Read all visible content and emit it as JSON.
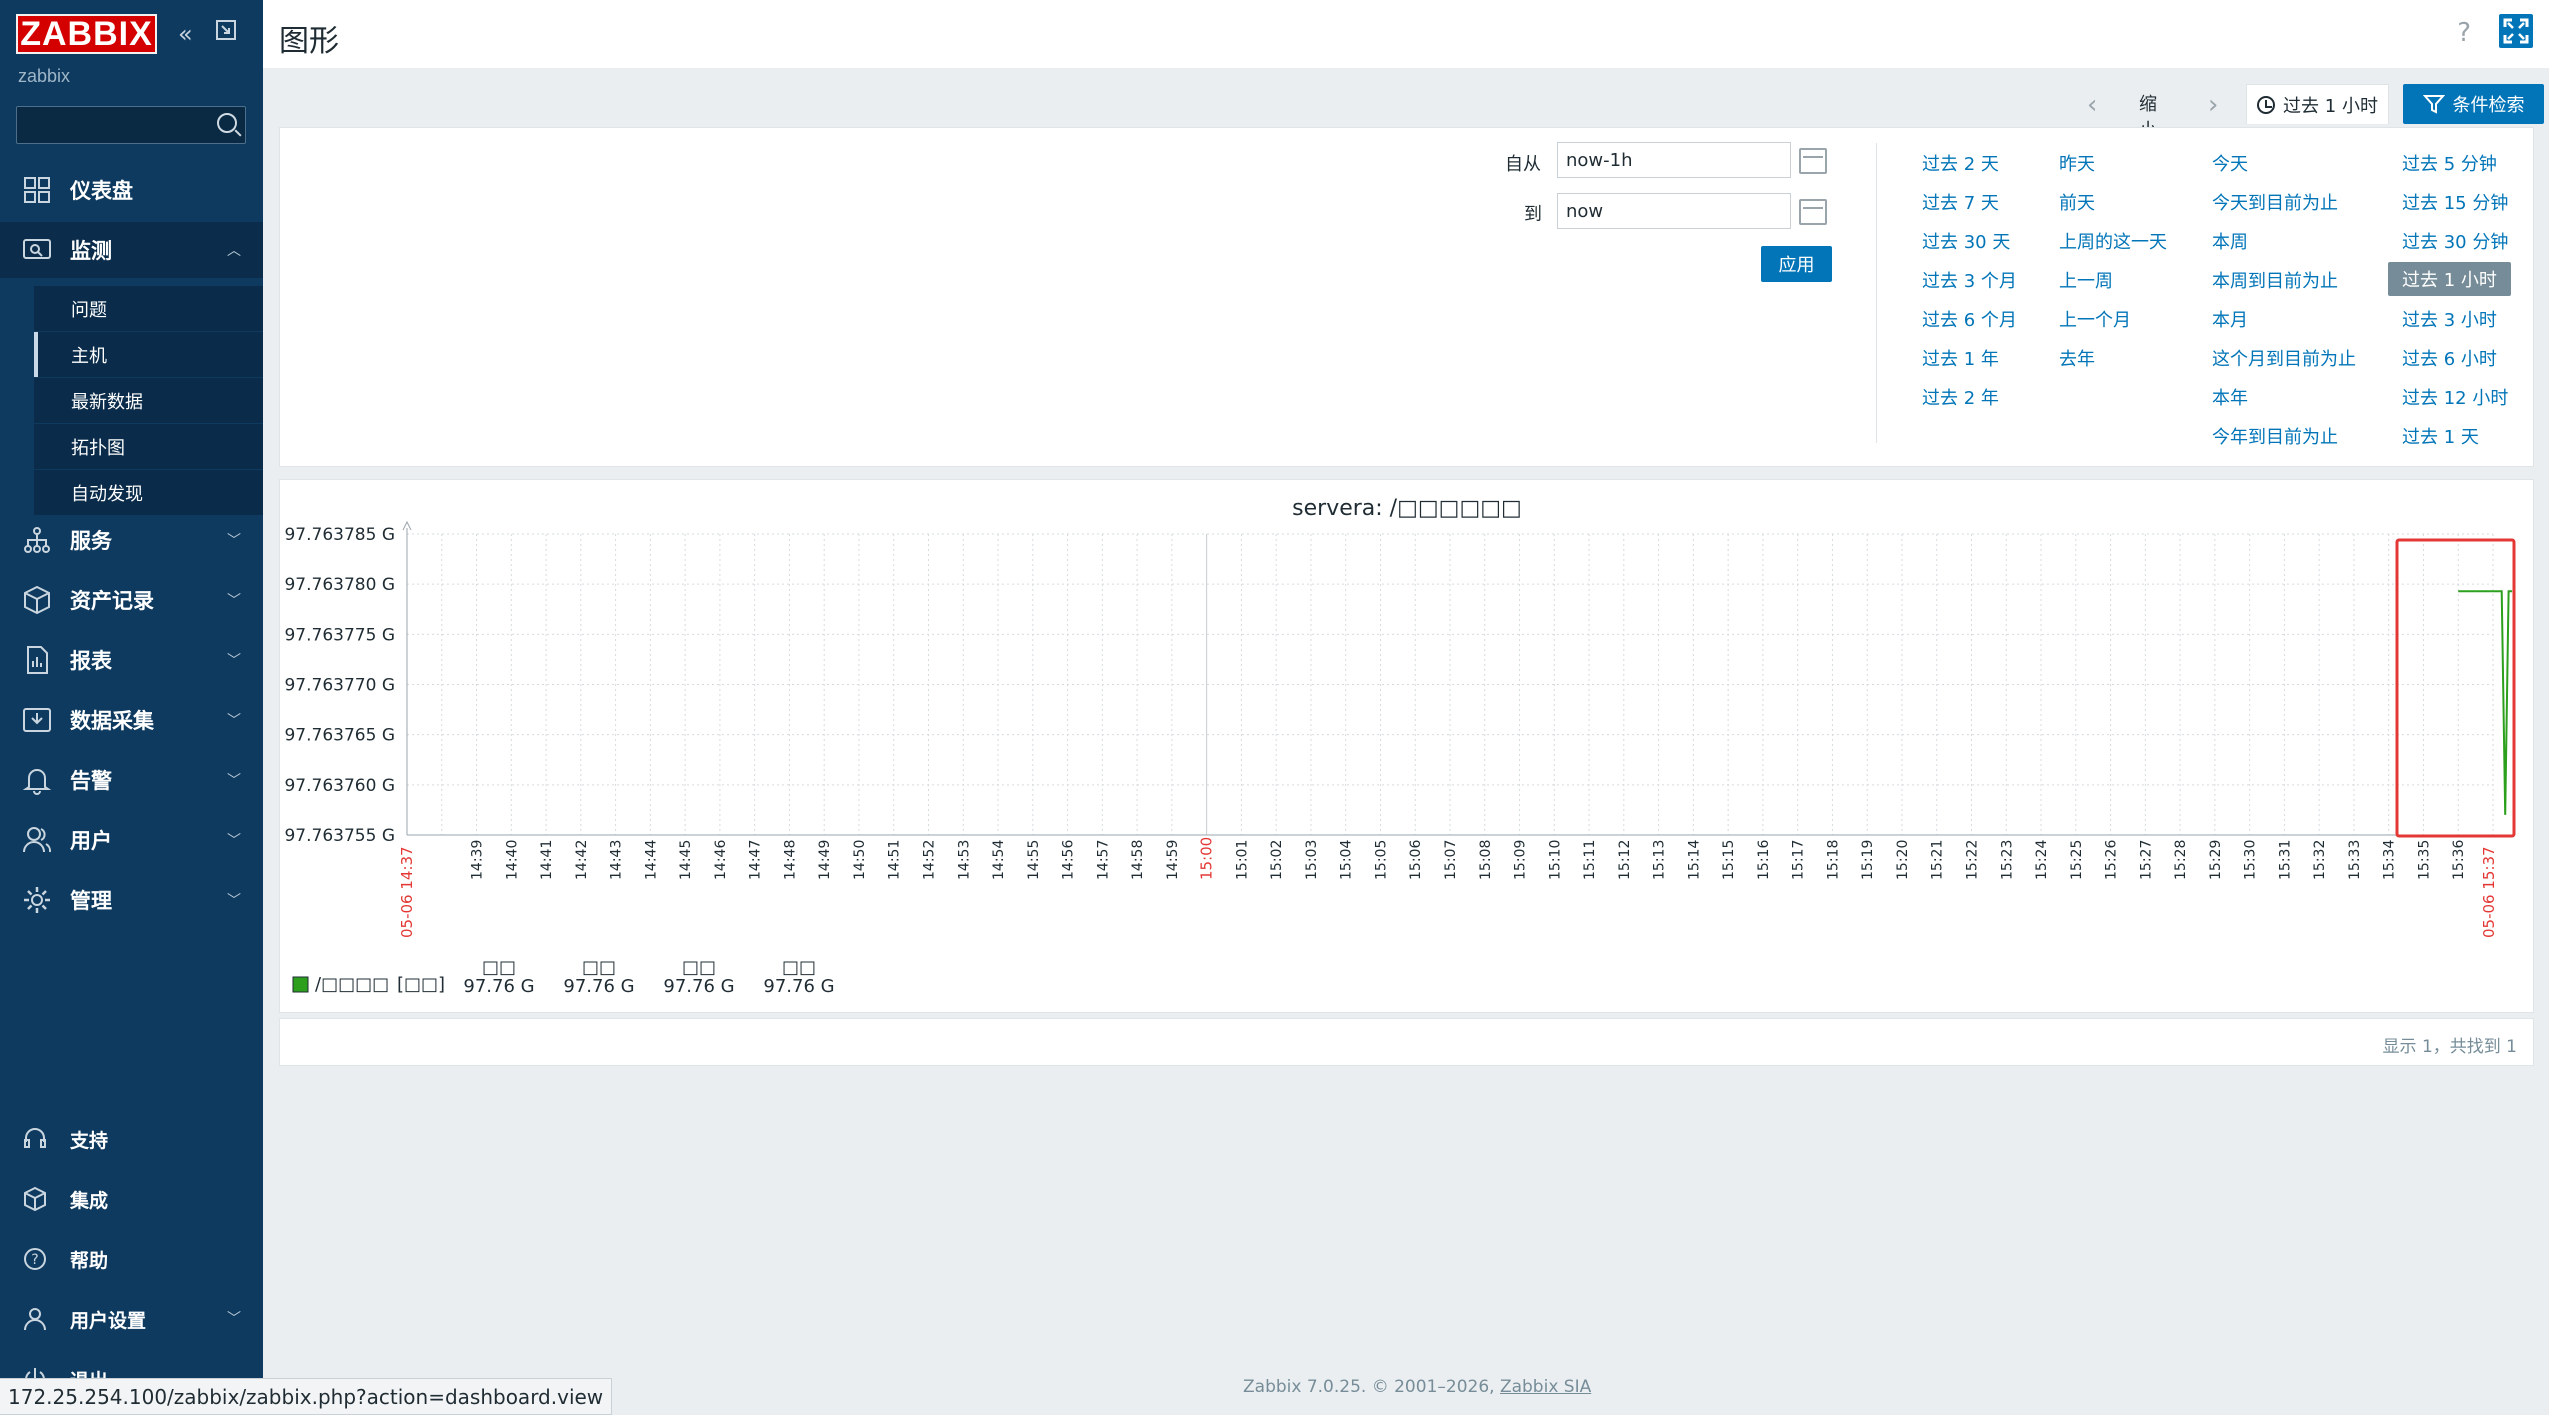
{
  "sidebar": {
    "logo": "ZABBIX",
    "instance": "zabbix",
    "search_placeholder": "",
    "items": [
      {
        "label": "仪表盘",
        "icon": "dashboard-icon"
      },
      {
        "label": "监测",
        "icon": "monitoring-icon",
        "expanded": true
      },
      {
        "label": "服务",
        "icon": "services-icon"
      },
      {
        "label": "资产记录",
        "icon": "inventory-icon"
      },
      {
        "label": "报表",
        "icon": "reports-icon"
      },
      {
        "label": "数据采集",
        "icon": "data-collection-icon"
      },
      {
        "label": "告警",
        "icon": "alerts-icon"
      },
      {
        "label": "用户",
        "icon": "users-icon"
      },
      {
        "label": "管理",
        "icon": "administration-icon"
      }
    ],
    "submenu": [
      "问题",
      "主机",
      "最新数据",
      "拓扑图",
      "自动发现"
    ],
    "submenu_selected": "主机",
    "bottom": [
      {
        "label": "支持",
        "icon": "support-icon"
      },
      {
        "label": "集成",
        "icon": "integrations-icon"
      },
      {
        "label": "帮助",
        "icon": "help-icon"
      },
      {
        "label": "用户设置",
        "icon": "user-settings-icon"
      },
      {
        "label": "退出",
        "icon": "sign-out-icon"
      }
    ]
  },
  "header": {
    "title": "图形",
    "help": "?"
  },
  "tabs": {
    "zoom_out": "缩小",
    "time_tab": "过去 1 小时",
    "filter_tab": "条件检索"
  },
  "filter": {
    "from_label": "自从",
    "from_value": "now-1h",
    "to_label": "到",
    "to_value": "now",
    "apply": "应用",
    "quick": [
      [
        "过去 2 天",
        "过去 7 天",
        "过去 30 天",
        "过去 3 个月",
        "过去 6 个月",
        "过去 1 年",
        "过去 2 年"
      ],
      [
        "昨天",
        "前天",
        "上周的这一天",
        "上一周",
        "上一个月",
        "去年"
      ],
      [
        "今天",
        "今天到目前为止",
        "本周",
        "本周到目前为止",
        "本月",
        "这个月到目前为止",
        "本年",
        "今年到目前为止"
      ],
      [
        "过去 5 分钟",
        "过去 15 分钟",
        "过去 30 分钟",
        "过去 1 小时",
        "过去 3 小时",
        "过去 6 小时",
        "过去 12 小时",
        "过去 1 天"
      ]
    ],
    "selected": "过去 1 小时"
  },
  "graph": {
    "title": "servera: /□□□□□□",
    "start_label": "05-06 14:37",
    "end_label": "05-06 15:37",
    "legend": {
      "name": "/□□□□",
      "func": "[□□]",
      "cols": [
        {
          "head": "□□",
          "value": "97.76 G"
        },
        {
          "head": "□□",
          "value": "97.76 G"
        },
        {
          "head": "□□",
          "value": "97.76 G"
        },
        {
          "head": "□□",
          "value": "97.76 G"
        }
      ]
    },
    "series_color": "#2ca01c",
    "highlight_color": "#e33734"
  },
  "chart_data": {
    "type": "line",
    "title": "servera: /□□□□□□",
    "xlabel": "",
    "ylabel": "",
    "y_unit": "G",
    "ylim": [
      97.763755,
      97.763785
    ],
    "yticks": [
      "97.763785 G",
      "97.763780 G",
      "97.763775 G",
      "97.763770 G",
      "97.763765 G",
      "97.763760 G",
      "97.763755 G"
    ],
    "xticks": [
      "14:39",
      "14:40",
      "14:41",
      "14:42",
      "14:43",
      "14:44",
      "14:45",
      "14:46",
      "14:47",
      "14:48",
      "14:49",
      "14:50",
      "14:51",
      "14:52",
      "14:53",
      "14:54",
      "14:55",
      "14:56",
      "14:57",
      "14:58",
      "14:59",
      "15:00",
      "15:01",
      "15:02",
      "15:03",
      "15:04",
      "15:05",
      "15:06",
      "15:07",
      "15:08",
      "15:09",
      "15:10",
      "15:11",
      "15:12",
      "15:13",
      "15:14",
      "15:15",
      "15:16",
      "15:17",
      "15:18",
      "15:19",
      "15:20",
      "15:21",
      "15:22",
      "15:23",
      "15:24",
      "15:25",
      "15:26",
      "15:27",
      "15:28",
      "15:29",
      "15:30",
      "15:31",
      "15:32",
      "15:33",
      "15:34",
      "15:35",
      "15:36"
    ],
    "x_range": [
      "14:37",
      "15:37"
    ],
    "series": [
      {
        "name": "/□□□□",
        "x": [
          "15:36.0",
          "15:37.2",
          "15:37.25",
          "15:37.35",
          "15:37.45",
          "15:37.55"
        ],
        "y": [
          97.7637793,
          97.7637793,
          97.7637793,
          97.763757,
          97.7637793,
          97.7637793
        ]
      }
    ],
    "grid": true
  },
  "paging": {
    "text": "显示 1，共找到 1"
  },
  "footer": {
    "text": "Zabbix 7.0.25. © 2001–2026, ",
    "link": "Zabbix SIA"
  },
  "status_bar": {
    "url": "172.25.254.100/zabbix/zabbix.php?action=dashboard.view"
  }
}
